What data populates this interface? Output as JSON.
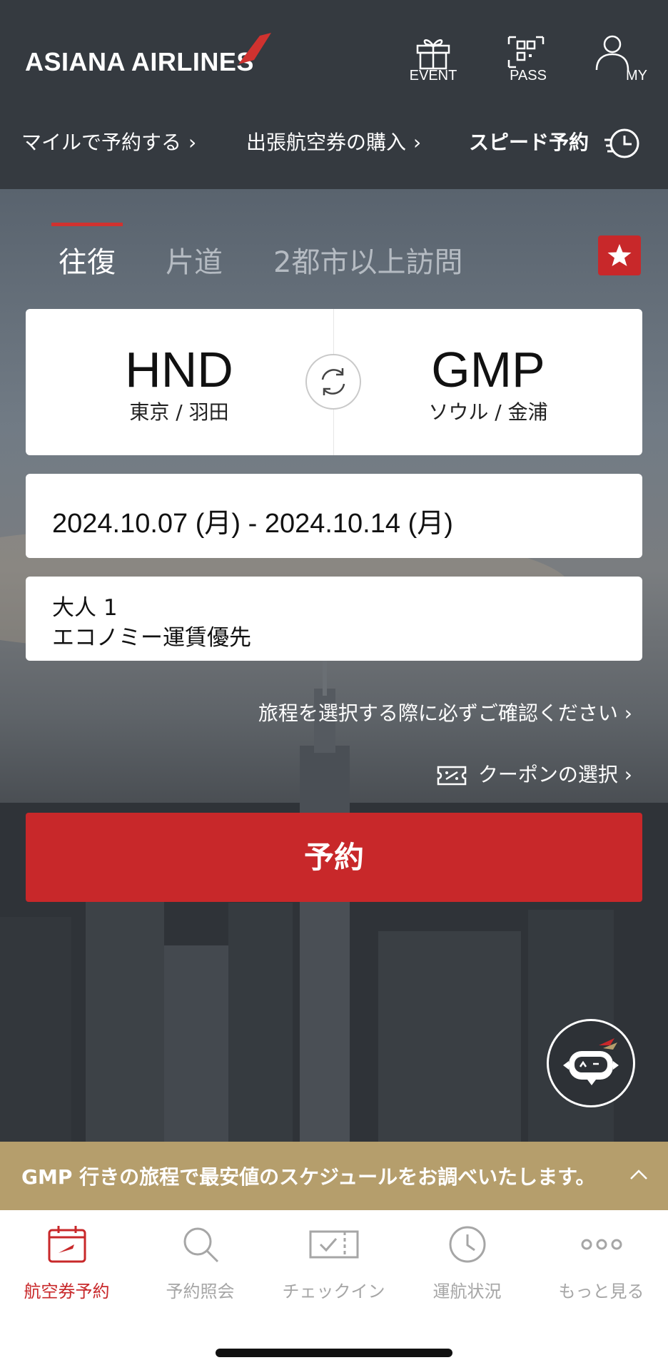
{
  "header": {
    "logo": "ASIANA AIRLINES",
    "icons": [
      {
        "label": "EVENT",
        "icon": "gift-icon"
      },
      {
        "label": "PASS",
        "icon": "qr-code-icon"
      },
      {
        "label": "MY",
        "icon": "user-icon"
      }
    ],
    "quicklinks": [
      {
        "label": "マイルで予約する"
      },
      {
        "label": "出張航空券の購入"
      },
      {
        "label": "スピード予約"
      }
    ]
  },
  "trip_tabs": [
    "往復",
    "片道",
    "2都市以上訪問"
  ],
  "route": {
    "from_code": "HND",
    "from_city": "東京 / 羽田",
    "to_code": "GMP",
    "to_city": "ソウル / 金浦"
  },
  "dates": "2024.10.07 (月) - 2024.10.14 (月)",
  "passengers": {
    "count": "大人 1",
    "fare": "エコノミー運賃優先"
  },
  "links": {
    "itinerary_notice": "旅程を選択する際に必ずご確認ください",
    "coupon": "クーポンの選択"
  },
  "reserve_button": "予約",
  "banner": "GMP 行きの旅程で最安値のスケジュールをお調べいたします。",
  "bottom_nav": [
    {
      "label": "航空券予約",
      "icon": "calendar-plane-icon",
      "active": true
    },
    {
      "label": "予約照会",
      "icon": "search-icon",
      "active": false
    },
    {
      "label": "チェックイン",
      "icon": "ticket-check-icon",
      "active": false
    },
    {
      "label": "運航状況",
      "icon": "clock-icon",
      "active": false
    },
    {
      "label": "もっと見る",
      "icon": "more-dots-icon",
      "active": false
    }
  ],
  "colors": {
    "header_bg": "#353a40",
    "accent_red": "#c8282a",
    "banner_gold": "#b59e6c"
  }
}
